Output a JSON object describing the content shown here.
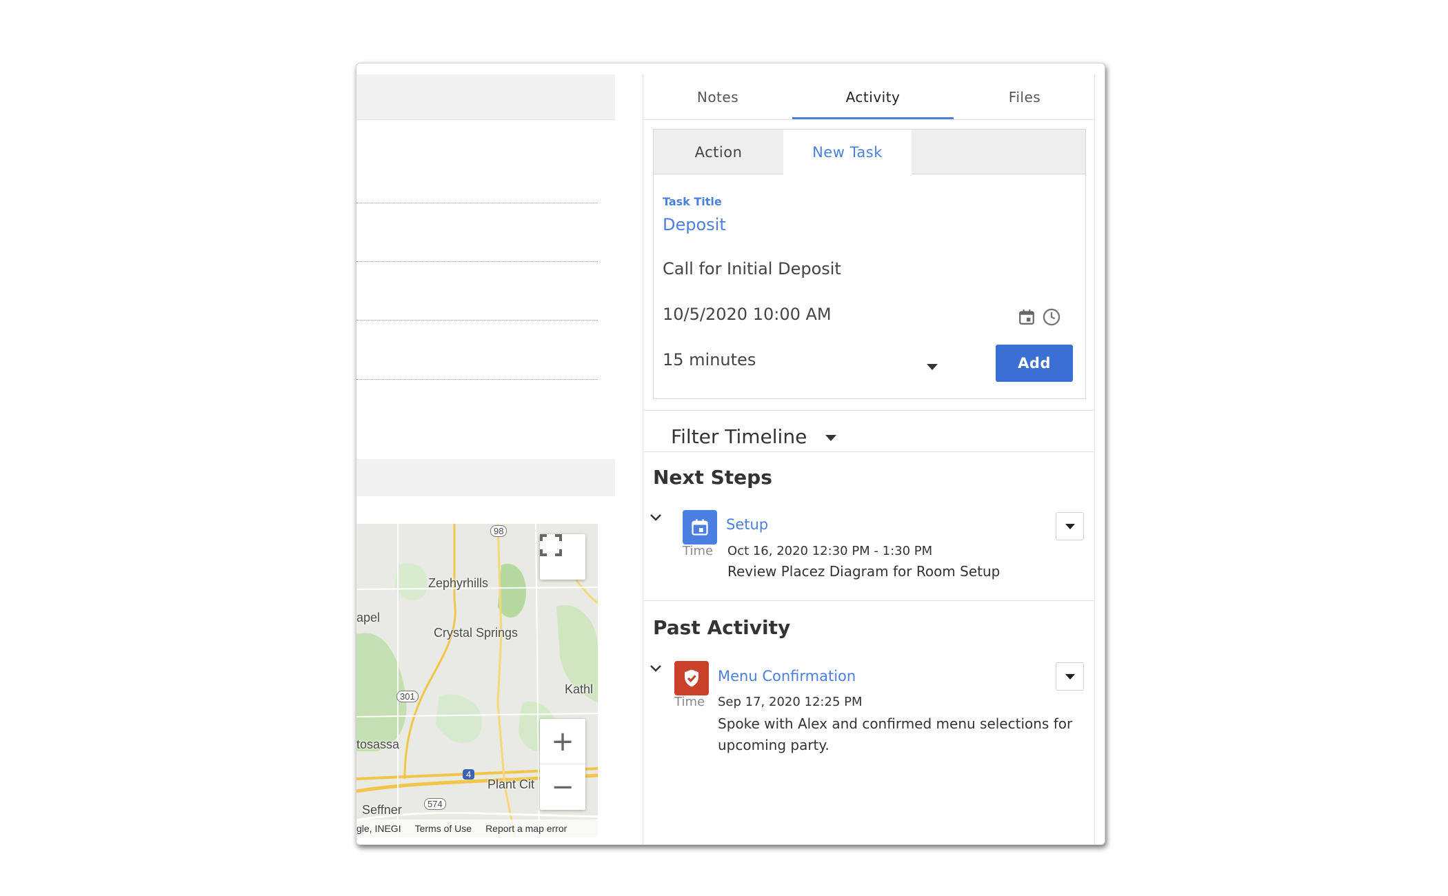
{
  "tabs": [
    {
      "label": "Notes",
      "active": false
    },
    {
      "label": "Activity",
      "active": true
    },
    {
      "label": "Files",
      "active": false
    }
  ],
  "task_form": {
    "subtabs": [
      {
        "label": "Action",
        "active": false
      },
      {
        "label": "New Task",
        "active": true
      }
    ],
    "title_label": "Task Title",
    "title_value": "Deposit",
    "description": "Call for Initial Deposit",
    "datetime": "10/5/2020 10:00 AM",
    "calendar_icon": "calendar-icon",
    "clock_icon": "clock-icon",
    "duration": "15 minutes",
    "add_label": "Add"
  },
  "filter": {
    "label": "Filter Timeline"
  },
  "next_steps": {
    "title": "Next Steps",
    "items": [
      {
        "icon": "calendar-icon",
        "icon_color": "#4a7fe0",
        "title": "Setup",
        "time_label": "Time",
        "time": "Oct 16, 2020 12:30 PM - 1:30 PM",
        "description": "Review Placez Diagram for Room Setup"
      }
    ]
  },
  "past_activity": {
    "title": "Past Activity",
    "items": [
      {
        "icon": "shield-check-icon",
        "icon_color": "#c9402b",
        "title": "Menu Confirmation",
        "time_label": "Time",
        "time": "Sep 17, 2020 12:25 PM",
        "description": "Spoke with Alex and confirmed menu selections for upcoming party."
      }
    ]
  },
  "map": {
    "places": [
      "Zephyrhills",
      "Crystal Springs",
      "apel",
      "Kathl",
      "tosassa",
      "Plant Cit",
      "Seffner"
    ],
    "shields": [
      "98",
      "301",
      "4",
      "574"
    ],
    "footer": [
      "gle, INEGI",
      "Terms of Use",
      "Report a map error"
    ],
    "zoom_in": "+",
    "zoom_out": "−"
  },
  "colors": {
    "accent": "#4a7fe0",
    "button": "#3b6fd4",
    "past_icon": "#c9402b"
  }
}
